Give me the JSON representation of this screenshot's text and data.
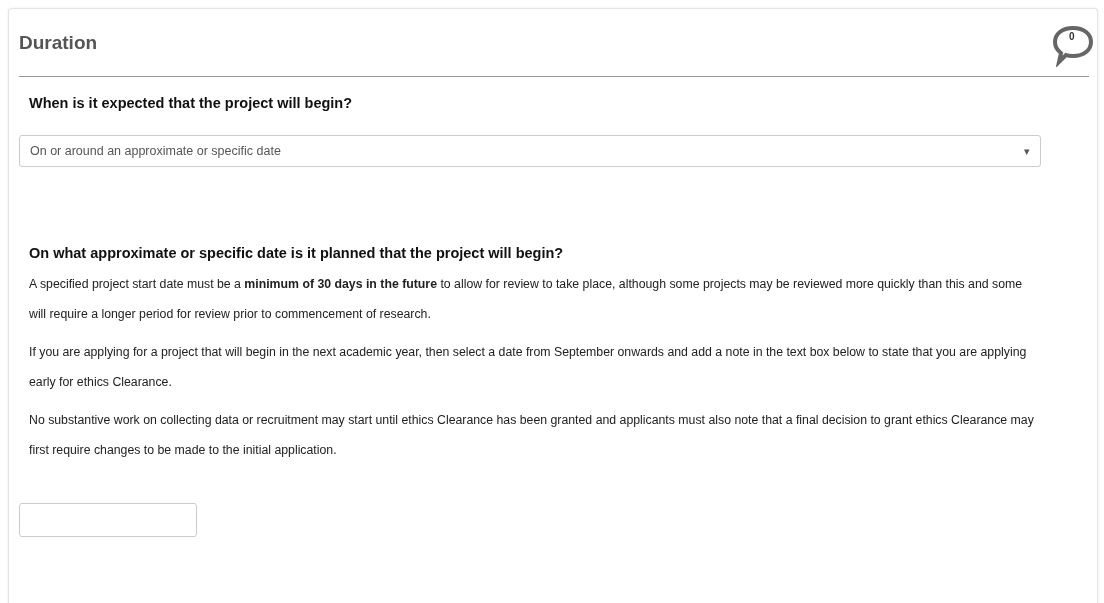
{
  "section": {
    "title": "Duration",
    "comment_count": "0"
  },
  "question_1": {
    "label": "When is it expected that the project will begin?",
    "select": {
      "value": "On or around an approximate or specific date",
      "caret": "▾"
    }
  },
  "question_2": {
    "label": "On what approximate or specific date is it planned that the project will begin?",
    "paragraphs": [
      "A specified project start date must be a **minimum of 30 days in the future** to allow for review to take place, although some projects may be reviewed more quickly than this and some will require a longer period for review prior to commencement of research.",
      "If you are applying for a project that will begin in the next academic year, then select a date from September onwards and add a note in the text box below to state that you are applying early for ethics Clearance.",
      "No substantive work on collecting data or recruitment may start until ethics Clearance has been granted and applicants must also note that a final decision to grant ethics Clearance may first require changes to be made to the initial application."
    ]
  }
}
